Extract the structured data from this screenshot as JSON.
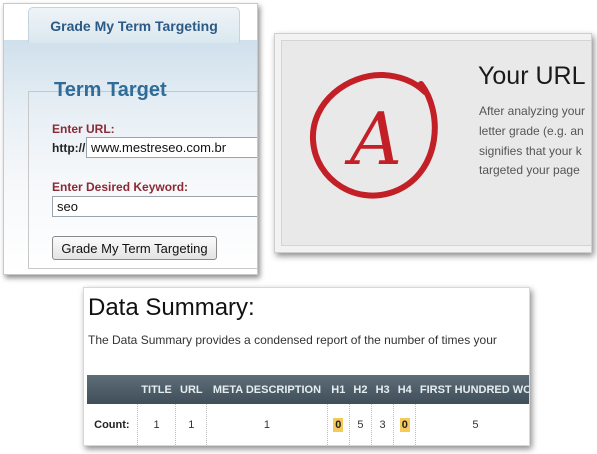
{
  "form_panel": {
    "tab_label": "Grade My Term Targeting",
    "legend": "Term Target",
    "url_label": "Enter URL:",
    "url_prefix": "http://",
    "url_value": "www.mestreseo.com.br",
    "keyword_label": "Enter Desired Keyword:",
    "keyword_value": "seo",
    "submit_label": "Grade My Term Targeting"
  },
  "grade_panel": {
    "heading": "Your URL",
    "grade_letter": "A",
    "desc_lines": [
      "After analyzing your",
      "letter grade (e.g. an",
      "signifies that your k",
      "targeted your page"
    ],
    "colors": {
      "grade_red": "#c21f26"
    }
  },
  "data_panel": {
    "title": "Data Summary:",
    "intro": "The Data Summary provides a condensed report of the number of times your",
    "columns": [
      "",
      "TITLE",
      "URL",
      "META DESCRIPTION",
      "H1",
      "H2",
      "H3",
      "H4",
      "FIRST HUNDRED WO"
    ],
    "row": {
      "label": "Count:",
      "values": [
        "1",
        "1",
        "1",
        "0",
        "5",
        "3",
        "0",
        "5"
      ]
    },
    "colors": {
      "header_bg": "#4a5a64",
      "highlight": "#f5c95c"
    }
  }
}
